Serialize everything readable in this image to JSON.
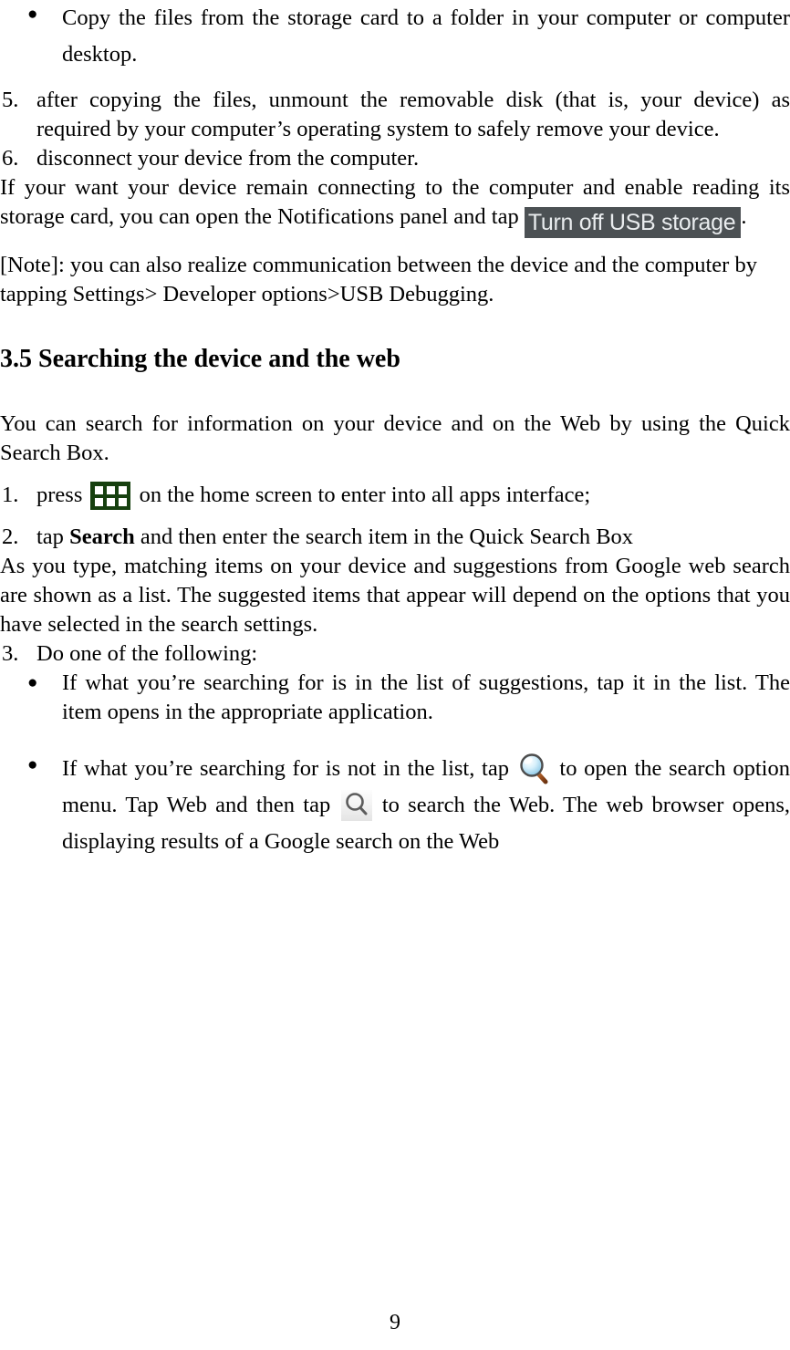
{
  "document": {
    "page_number": "9",
    "colors": {
      "usb_button_bg": "#4c5154",
      "usb_button_text": "#e9ecee",
      "apps_icon_bg": "#16400f",
      "apps_icon_cell": "#ffffff",
      "magnifier_lens": "#bfe4f7",
      "magnifier_rim": "#4d4d4d",
      "magnifier_handle": "#9a4f1e",
      "text": "#000000",
      "background": "#ffffff"
    }
  },
  "blocks": {
    "bullet_copy_files": {
      "marker": "●",
      "text": "Copy the files from the storage card to a folder in your computer or computer desktop."
    },
    "item_5": {
      "number": "5.",
      "text": "after copying the files, unmount the removable disk (that is, your device) as required by your computer’s operating system to safely remove your device."
    },
    "item_6": {
      "number": "6.",
      "text": "disconnect your device from the computer."
    },
    "usb_paragraph": {
      "text_before": "If your want your device remain connecting to the computer and enable reading its storage card, you can open the Notifications panel and tap",
      "button_label": "Turn off USB storage",
      "text_after": "."
    },
    "note_paragraph": {
      "text": "[Note]: you can also realize communication between the device and the computer by tapping Settings> Developer options>USB Debugging."
    },
    "section_heading": {
      "text": "3.5 Searching the device and the web"
    },
    "intro_paragraph": {
      "text": "You can search for information on your device and on the Web by using the Quick Search Box."
    },
    "item_1": {
      "number": "1.",
      "text_before": "press",
      "icon_name": "all-apps-grid-icon",
      "text_after": "on the home screen to enter into all apps interface;"
    },
    "item_2": {
      "number": "2.",
      "text_before": "tap",
      "bold_word": "Search",
      "text_after": "and then enter the search item in the Quick Search Box"
    },
    "as_you_type_paragraph": {
      "text": "As you type, matching items on your device and suggestions from Google web search are shown as a list. The suggested items that appear will depend on the options that you have selected in the search settings."
    },
    "item_3": {
      "number": "3.",
      "text": "Do one of the following:"
    },
    "bullet_in_list": {
      "marker": "●",
      "text": "If what you’re searching for is in the list of suggestions, tap it in the list. The item opens in the appropriate application."
    },
    "bullet_not_in_list": {
      "marker": "●",
      "text_part1": "If what you’re searching for is not in the list, tap",
      "icon1_name": "search-magnifier-glossy-icon",
      "text_part2": "to open the search option menu. Tap Web and then tap",
      "icon2_name": "search-magnifier-flat-icon",
      "text_part3": "to search the Web. The web browser opens, displaying results of a Google search on the Web"
    }
  }
}
